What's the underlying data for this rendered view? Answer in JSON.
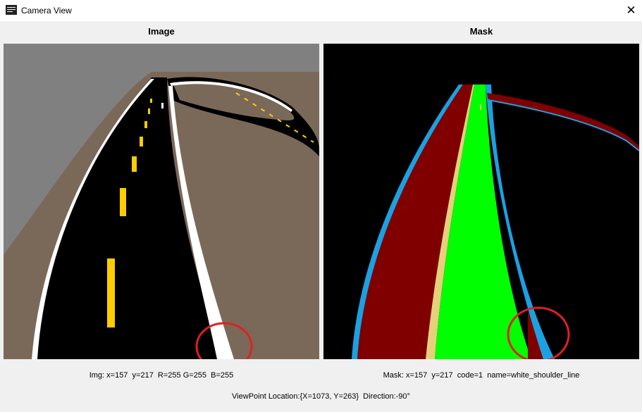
{
  "window": {
    "title": "Camera View",
    "close_glyph": "✕",
    "icon": "camera-window-icon"
  },
  "image_panel": {
    "label": "Image",
    "info": "Img: x=157  y=217  R=255 G=255  B=255"
  },
  "mask_panel": {
    "label": "Mask",
    "info": "Mask: x=157  y=217  code=1  name=white_shoulder_line"
  },
  "viewpoint": {
    "text": "ViewPoint Location:{X=1073, Y=263}  Direction:-90°"
  },
  "colors": {
    "sky": "#808080",
    "ground": "#7a6959",
    "road": "#000000",
    "white_line": "#ffffff",
    "yellow_line": "#ffcc00",
    "mask_background": "#000000",
    "mask_red": "#800000",
    "mask_green": "#00ff00",
    "mask_blue": "#1ba1e2",
    "mask_yellow": "#e6d07a",
    "highlight_circle": "#e02020"
  }
}
